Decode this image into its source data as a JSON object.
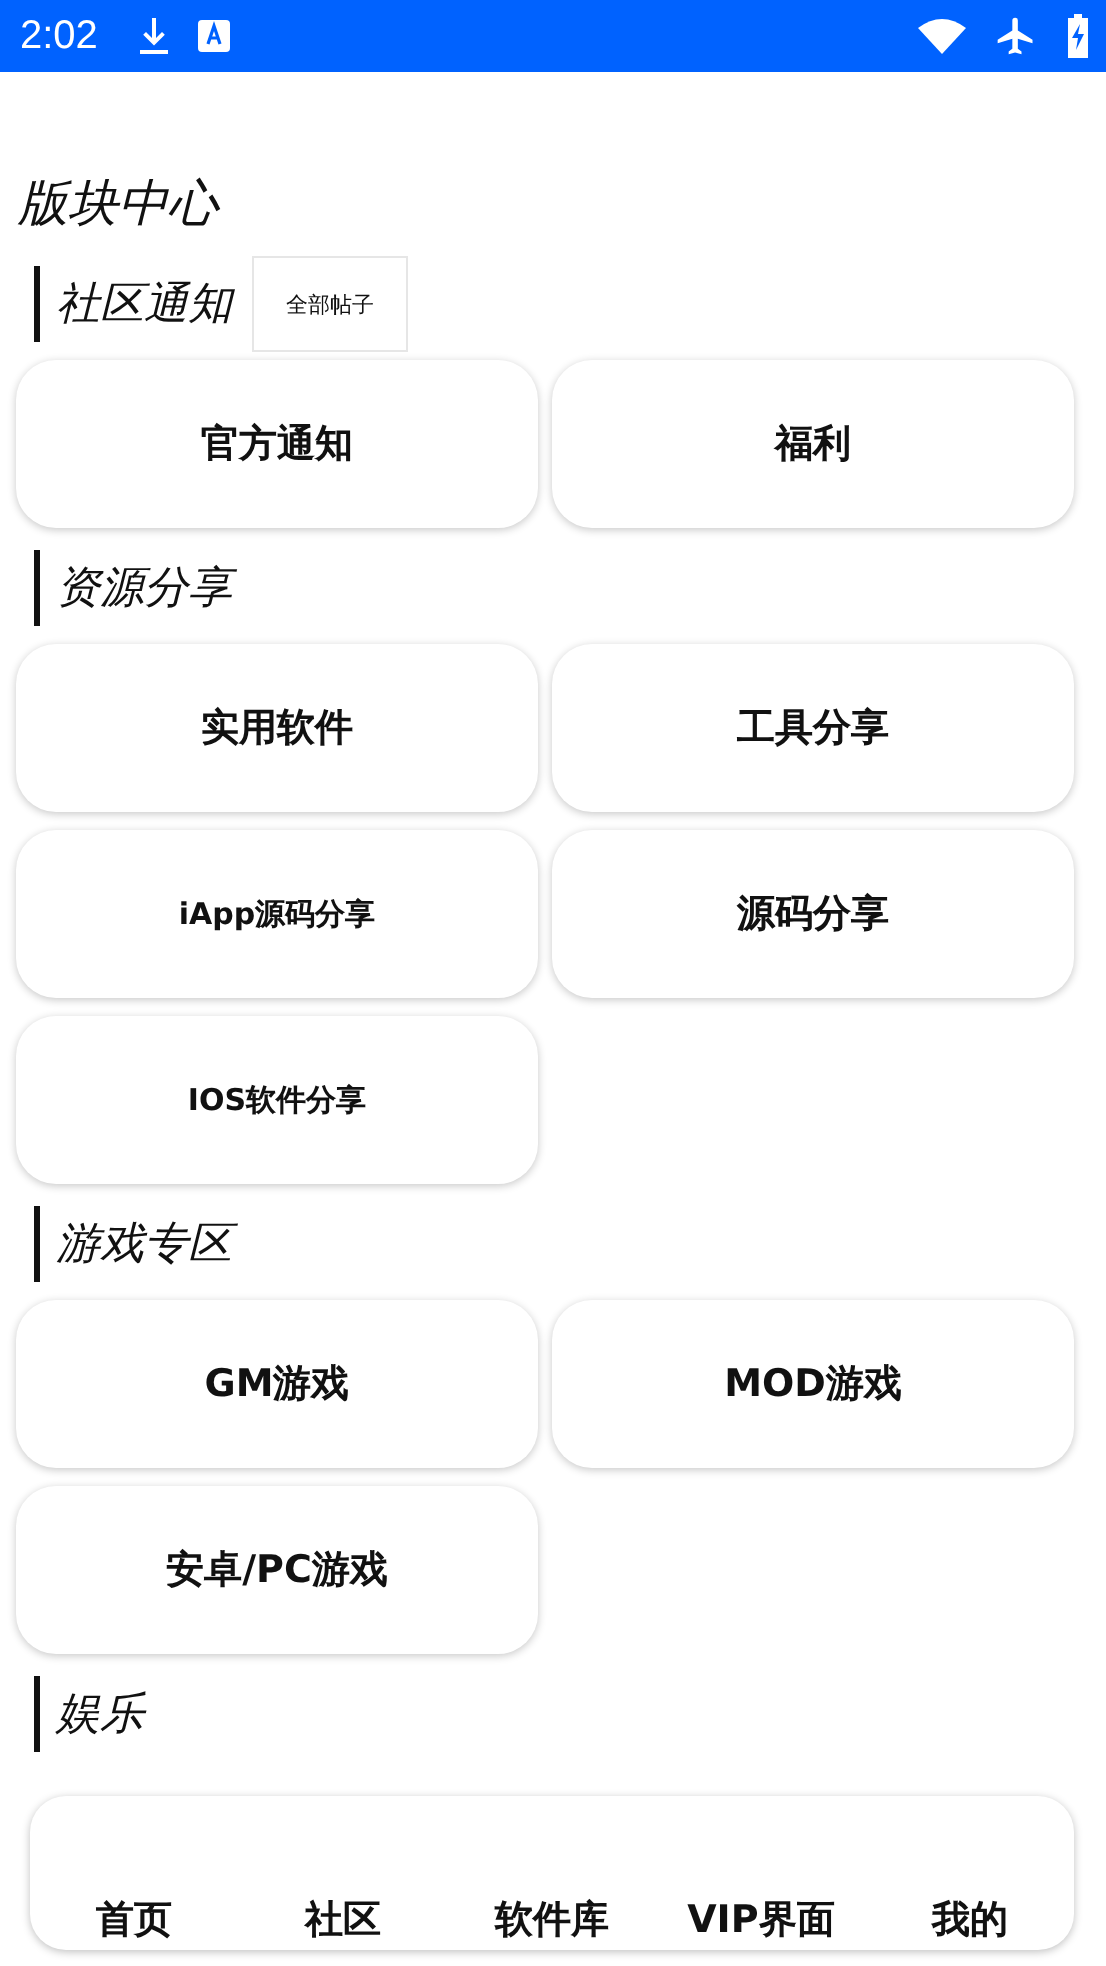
{
  "status_bar": {
    "time": "2:02"
  },
  "title": "版块中心",
  "sections": [
    {
      "title": "社区通知",
      "button": "全部帖子",
      "cards": [
        {
          "label": "官方通知",
          "kind": "normal"
        },
        {
          "label": "福利",
          "kind": "normal"
        }
      ]
    },
    {
      "title": "资源分享",
      "cards": [
        {
          "label": "实用软件",
          "kind": "normal"
        },
        {
          "label": "工具分享",
          "kind": "normal"
        },
        {
          "label": "iApp源码分享",
          "kind": "compact"
        },
        {
          "label": "源码分享",
          "kind": "normal"
        },
        {
          "label": "IOS软件分享",
          "kind": "compact"
        }
      ]
    },
    {
      "title": "游戏专区",
      "cards": [
        {
          "label": "GM游戏",
          "kind": "normal"
        },
        {
          "label": "MOD游戏",
          "kind": "normal"
        },
        {
          "label": "安卓/PC游戏",
          "kind": "normal"
        }
      ]
    },
    {
      "title": "娱乐"
    }
  ],
  "bottom_nav": [
    "首页",
    "社区",
    "软件库",
    "VIP界面",
    "我的"
  ]
}
